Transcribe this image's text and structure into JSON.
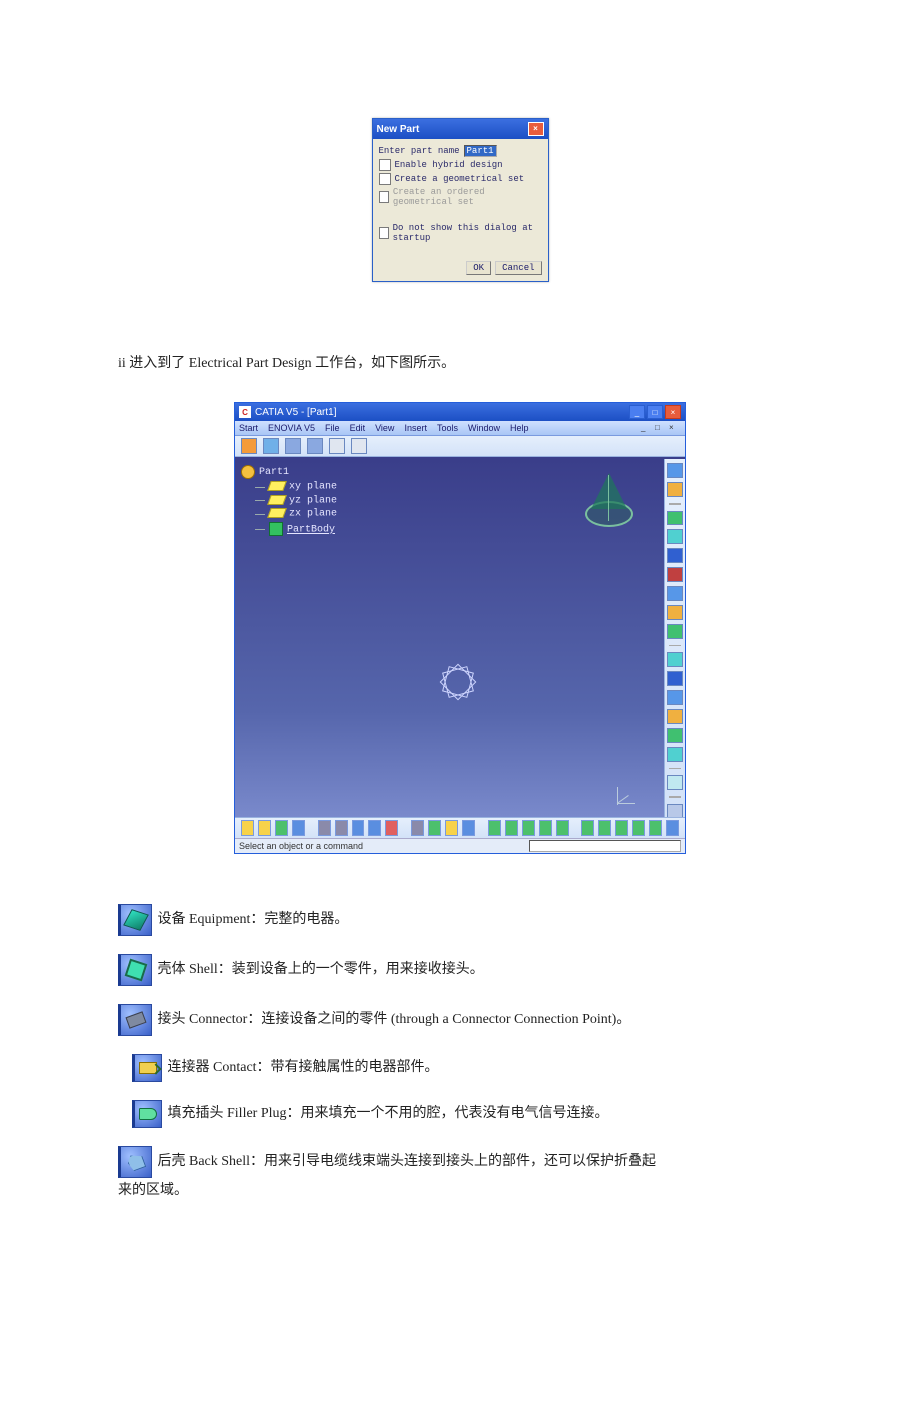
{
  "dialog": {
    "title": "New Part",
    "enter_name_label": "Enter part name",
    "part_name_value": "Part1",
    "opt_hybrid": "Enable hybrid design",
    "opt_geomset": "Create a geometrical set",
    "opt_ordered": "Create an ordered geometrical set",
    "opt_dontshow": "Do not show this dialog at startup",
    "ok": "OK",
    "cancel": "Cancel"
  },
  "para1": "ii 进入到了 Electrical Part Design 工作台，如下图所示。",
  "catia": {
    "title": "CATIA V5 - [Part1]",
    "menus": [
      "Start",
      "ENOVIA V5",
      "File",
      "Edit",
      "View",
      "Insert",
      "Tools",
      "Window",
      "Help"
    ],
    "tree": {
      "root": "Part1",
      "planes": [
        "xy plane",
        "yz plane",
        "zx plane"
      ],
      "body": "PartBody"
    },
    "status": "Select an object or a command"
  },
  "defs": {
    "equipment": "设备 Equipment：完整的电器。",
    "shell": "壳体 Shell：装到设备上的一个零件，用来接收接头。",
    "connector": "接头 Connector：连接设备之间的零件 (through a Connector Connection Point)。",
    "contact": "连接器 Contact：带有接触属性的电器部件。",
    "filler": "填充插头 Filler Plug：用来填充一个不用的腔，代表没有电气信号连接。",
    "backshell": "后壳 Back Shell：用来引导电缆线束端头连接到接头上的部件，还可以保护折叠起",
    "backshell_cont": "来的区域。"
  }
}
